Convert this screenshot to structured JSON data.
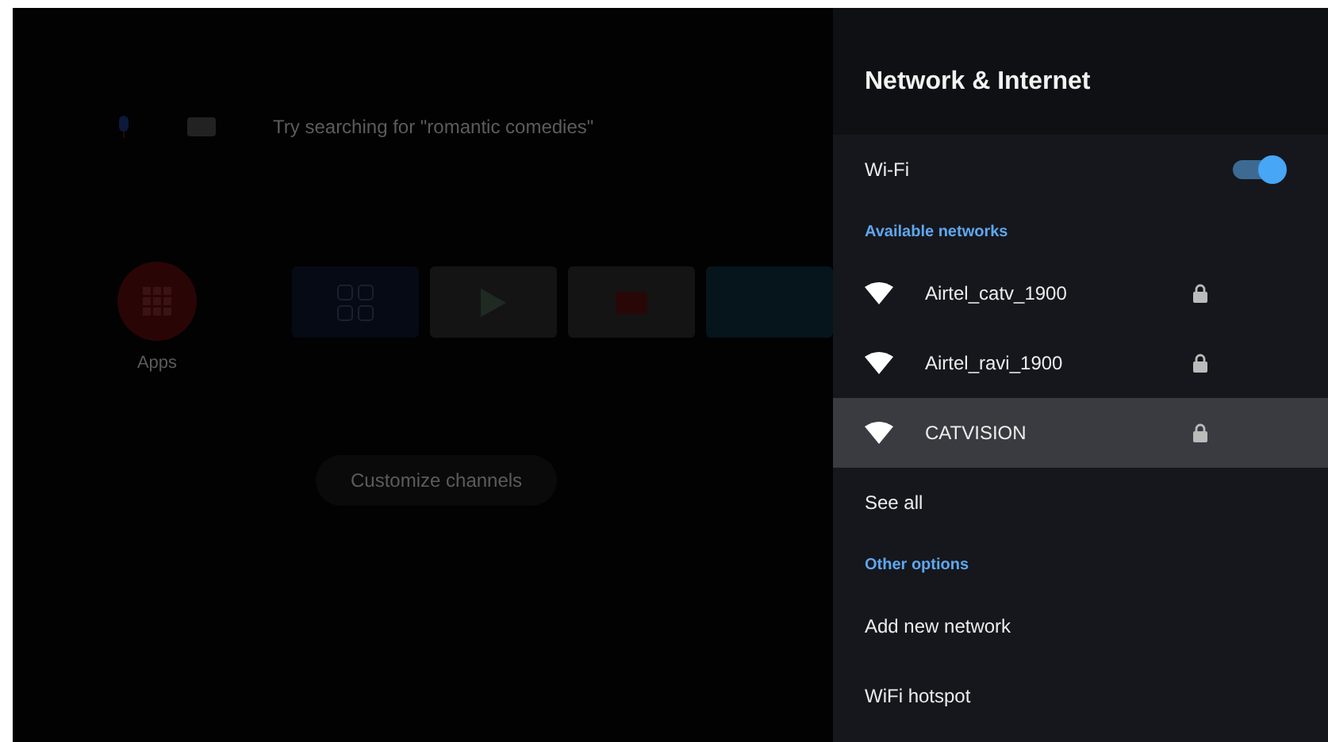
{
  "home": {
    "search": {
      "placeholder": "Try searching for \"romantic comedies\""
    },
    "apps_label": "Apps",
    "tiles": [
      {
        "kind": "grid"
      },
      {
        "kind": "play"
      },
      {
        "kind": "video"
      },
      {
        "kind": "stream"
      }
    ],
    "customize_button": "Customize channels"
  },
  "panel": {
    "title": "Network & Internet",
    "wifi": {
      "label": "Wi-Fi",
      "on": true
    },
    "available_header": "Available networks",
    "networks": [
      {
        "name": "Airtel_catv_1900",
        "locked": true,
        "selected": false
      },
      {
        "name": "Airtel_ravi_1900",
        "locked": true,
        "selected": false
      },
      {
        "name": "CATVISION",
        "locked": true,
        "selected": true
      }
    ],
    "see_all": "See all",
    "other_header": "Other options",
    "options": [
      "Add new network",
      "WiFi hotspot"
    ]
  }
}
